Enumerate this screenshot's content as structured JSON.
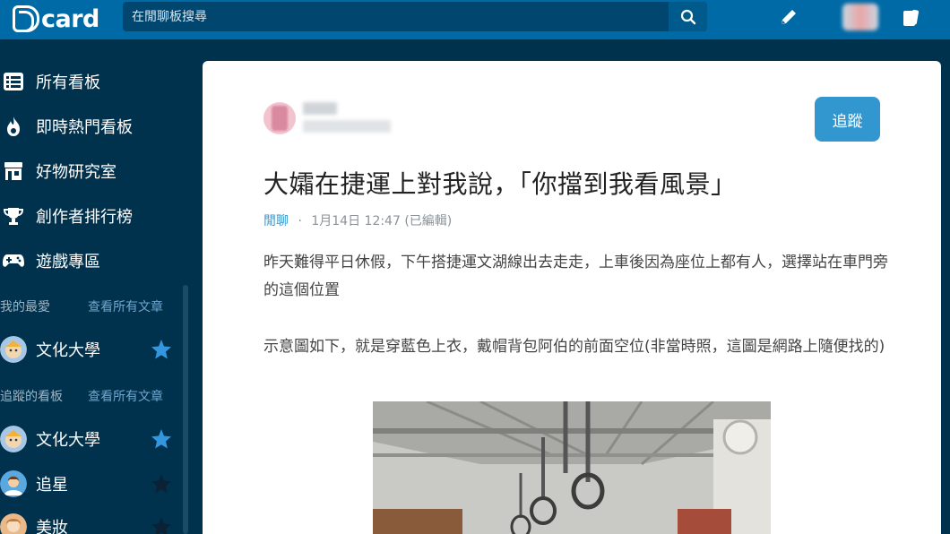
{
  "app": {
    "logo_text": "card"
  },
  "search": {
    "placeholder": "在閒聊板搜尋"
  },
  "sidebar": {
    "nav": [
      {
        "label": "所有看板",
        "icon": "list-icon"
      },
      {
        "label": "即時熱門看板",
        "icon": "fire-icon"
      },
      {
        "label": "好物研究室",
        "icon": "shop-icon"
      },
      {
        "label": "創作者排行榜",
        "icon": "trophy-icon"
      },
      {
        "label": "遊戲專區",
        "icon": "gamepad-icon"
      }
    ],
    "favorites": {
      "title": "我的最愛",
      "link": "查看所有文章",
      "items": [
        {
          "label": "文化大學",
          "starred": true
        }
      ]
    },
    "followed": {
      "title": "追蹤的看板",
      "link": "查看所有文章",
      "items": [
        {
          "label": "文化大學",
          "starred": true
        },
        {
          "label": "追星",
          "starred": false
        },
        {
          "label": "美妝",
          "starred": false
        }
      ]
    }
  },
  "post": {
    "follow_label": "追蹤",
    "title": "大孀在捷運上對我說，「你擋到我看風景」",
    "forum": "閒聊",
    "separator": "·",
    "datetime": "1月14日 12:47",
    "edited": "(已編輯)",
    "paragraphs": [
      "昨天難得平日休假，下午搭捷運文湖線出去走走，上車後因為座位上都有人，選擇站在車門旁的這個位置",
      "示意圖如下，就是穿藍色上衣，戴帽背包阿伯的前面空位(非當時照，這圖是網路上隨便找的)"
    ]
  },
  "colors": {
    "topbar": "#006aa6",
    "sidebar": "#00324e",
    "accent": "#3397cf",
    "star_active": "#3397e0"
  }
}
